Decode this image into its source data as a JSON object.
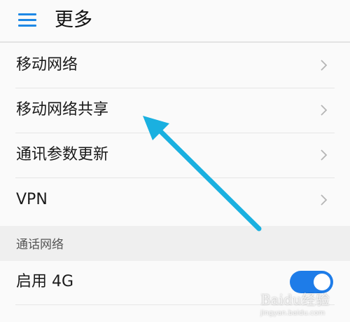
{
  "header": {
    "menu_icon": "hamburger-menu-icon",
    "title": "更多"
  },
  "list": {
    "items": [
      {
        "label": "移动网络",
        "icon": "chevron-right-icon"
      },
      {
        "label": "移动网络共享",
        "icon": "chevron-right-icon"
      },
      {
        "label": "通讯参数更新",
        "icon": "chevron-right-icon"
      },
      {
        "label": "VPN",
        "icon": "chevron-right-icon"
      }
    ]
  },
  "section": {
    "label": "通话网络"
  },
  "toggle_row": {
    "label": "启用 4G",
    "enabled": true
  },
  "annotation": {
    "arrow_color": "#1ab0e0"
  },
  "watermark": {
    "logo": "Baidu经验",
    "url": "jingyan.baidu.com"
  },
  "colors": {
    "accent": "#1e88e5",
    "toggle_on": "#1e7ce8",
    "background": "#fafafa",
    "section_background": "#efefef"
  }
}
